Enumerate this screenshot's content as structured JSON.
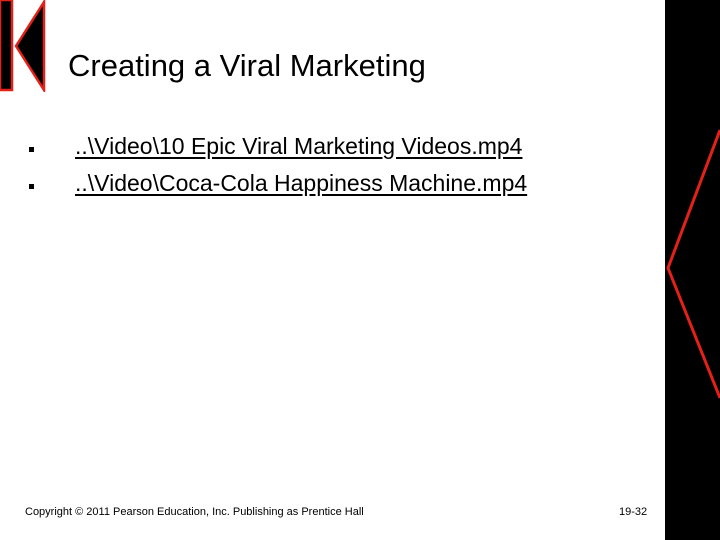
{
  "slide": {
    "title": "Creating a Viral Marketing",
    "links": [
      "..\\Video\\10 Epic Viral Marketing Videos.mp4",
      "..\\Video\\Coca-Cola Happiness Machine.mp4"
    ],
    "footer": "Copyright © 2011 Pearson Education, Inc.  Publishing as Prentice Hall",
    "page_number": "19-32"
  },
  "colors": {
    "accent_red": "#e32119",
    "band_black": "#000000",
    "text": "#000000",
    "background": "#ffffff"
  },
  "icons": {
    "logo": "k-chevron-logo-icon",
    "side_band": "red-chevron-edge-icon"
  }
}
